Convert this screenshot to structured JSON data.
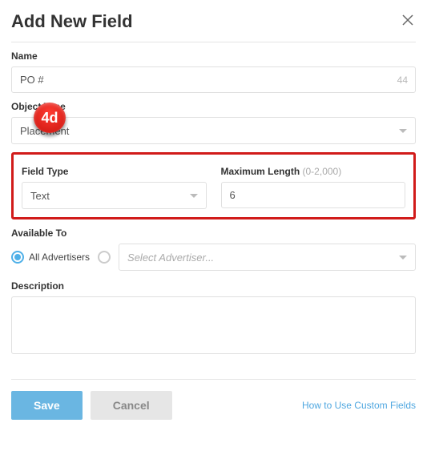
{
  "header": {
    "title": "Add New Field"
  },
  "name": {
    "label": "Name",
    "value": "PO #",
    "remaining": "44"
  },
  "objectType": {
    "label": "Object Type",
    "value": "Placement"
  },
  "fieldType": {
    "label": "Field Type",
    "value": "Text"
  },
  "maxLength": {
    "label": "Maximum Length ",
    "hint": "(0-2,000)",
    "value": "6"
  },
  "availableTo": {
    "label": "Available To",
    "allLabel": "All Advertisers",
    "selectPlaceholder": "Select Advertiser..."
  },
  "description": {
    "label": "Description",
    "value": ""
  },
  "footer": {
    "save": "Save",
    "cancel": "Cancel",
    "help": "How to Use Custom Fields"
  },
  "annotation": {
    "badge": "4d"
  }
}
